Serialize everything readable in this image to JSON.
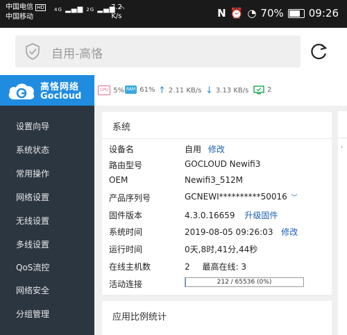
{
  "status_bar": {
    "carrier1": "中国电信",
    "carrier2": "中国移动",
    "hd": "HD",
    "signal1": "4G",
    "signal2": "2G",
    "speed_value": "7.2",
    "speed_unit": "K/s",
    "battery": "70%",
    "time": "09:26"
  },
  "browser": {
    "url_text": "自用-高恪"
  },
  "logo": {
    "name_cn": "高恪网络",
    "name_en": "Gocloud"
  },
  "stats": {
    "cpu_label": "CPU",
    "cpu": "5%",
    "ram_label": "RAM",
    "ram": "61%",
    "upload": "2.11 KB/s",
    "download": "3.13 KB/s",
    "devices": "2"
  },
  "sidebar": {
    "items": [
      {
        "label": "设置向导"
      },
      {
        "label": "系统状态"
      },
      {
        "label": "常用操作"
      },
      {
        "label": "网络设置"
      },
      {
        "label": "无线设置"
      },
      {
        "label": "多线设置"
      },
      {
        "label": "QoS流控"
      },
      {
        "label": "网络安全"
      },
      {
        "label": "分组管理"
      }
    ]
  },
  "system_panel": {
    "title": "系统",
    "rows": [
      {
        "label": "设备名",
        "value": "自用",
        "action": "修改"
      },
      {
        "label": "路由型号",
        "value": "GOCLOUD Newifi3"
      },
      {
        "label": "OEM",
        "value": "Newifi3_512M"
      },
      {
        "label": "产品序列号",
        "value": "GCNEWI**********50016"
      },
      {
        "label": "固件版本",
        "value": "4.3.0.16659",
        "action": "升级固件"
      },
      {
        "label": "系统时间",
        "value": "2019-08-05 09:26:03",
        "action": "修改"
      },
      {
        "label": "运行时间",
        "value": "0天,8时,41分,44秒"
      },
      {
        "label": "在线主机数",
        "value": "2",
        "extra_label": "最高在线:",
        "extra_value": "3"
      },
      {
        "label": "活动连接",
        "value": "212 / 65536 (0%)"
      }
    ],
    "connection_fraction": 0.0032
  },
  "app_panel": {
    "title": "应用比例统计"
  }
}
